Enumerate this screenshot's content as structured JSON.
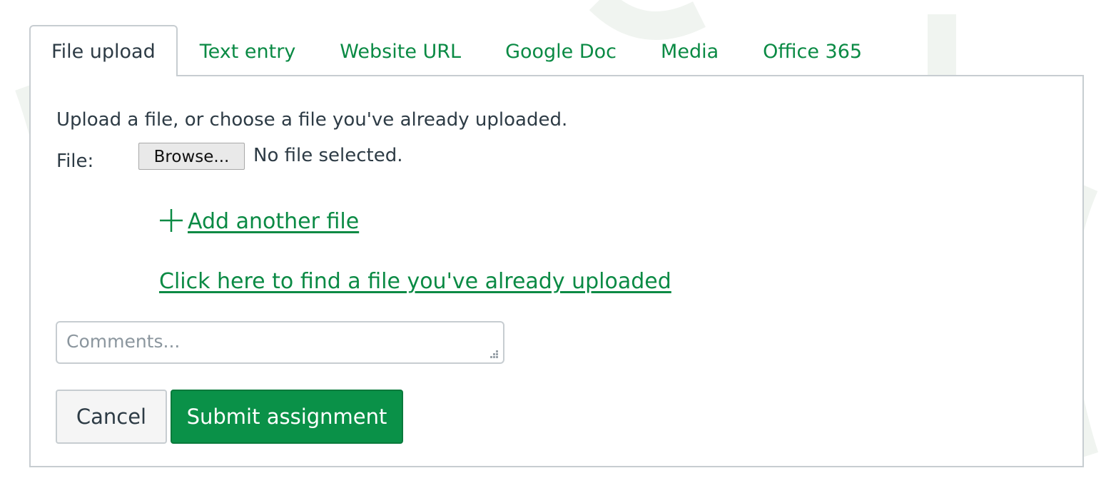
{
  "tabs": [
    {
      "label": "File upload",
      "active": true
    },
    {
      "label": "Text entry",
      "active": false
    },
    {
      "label": "Website URL",
      "active": false
    },
    {
      "label": "Google Doc",
      "active": false
    },
    {
      "label": "Media",
      "active": false
    },
    {
      "label": "Office 365",
      "active": false
    }
  ],
  "upload": {
    "intro": "Upload a file, or choose a file you've already uploaded.",
    "file_label": "File:",
    "browse_label": "Browse...",
    "no_file_text": "No file selected.",
    "add_file_label": " Add another file",
    "add_file_icon": "plus-icon",
    "find_file_label": "Click here to find a file you've already uploaded"
  },
  "comments": {
    "placeholder": "Comments...",
    "value": ""
  },
  "actions": {
    "cancel_label": "Cancel",
    "submit_label": "Submit assignment"
  },
  "colors": {
    "link": "#0a8a44",
    "primary_button": "#0a9148",
    "border": "#c7cdd1",
    "text": "#2d3b45"
  }
}
